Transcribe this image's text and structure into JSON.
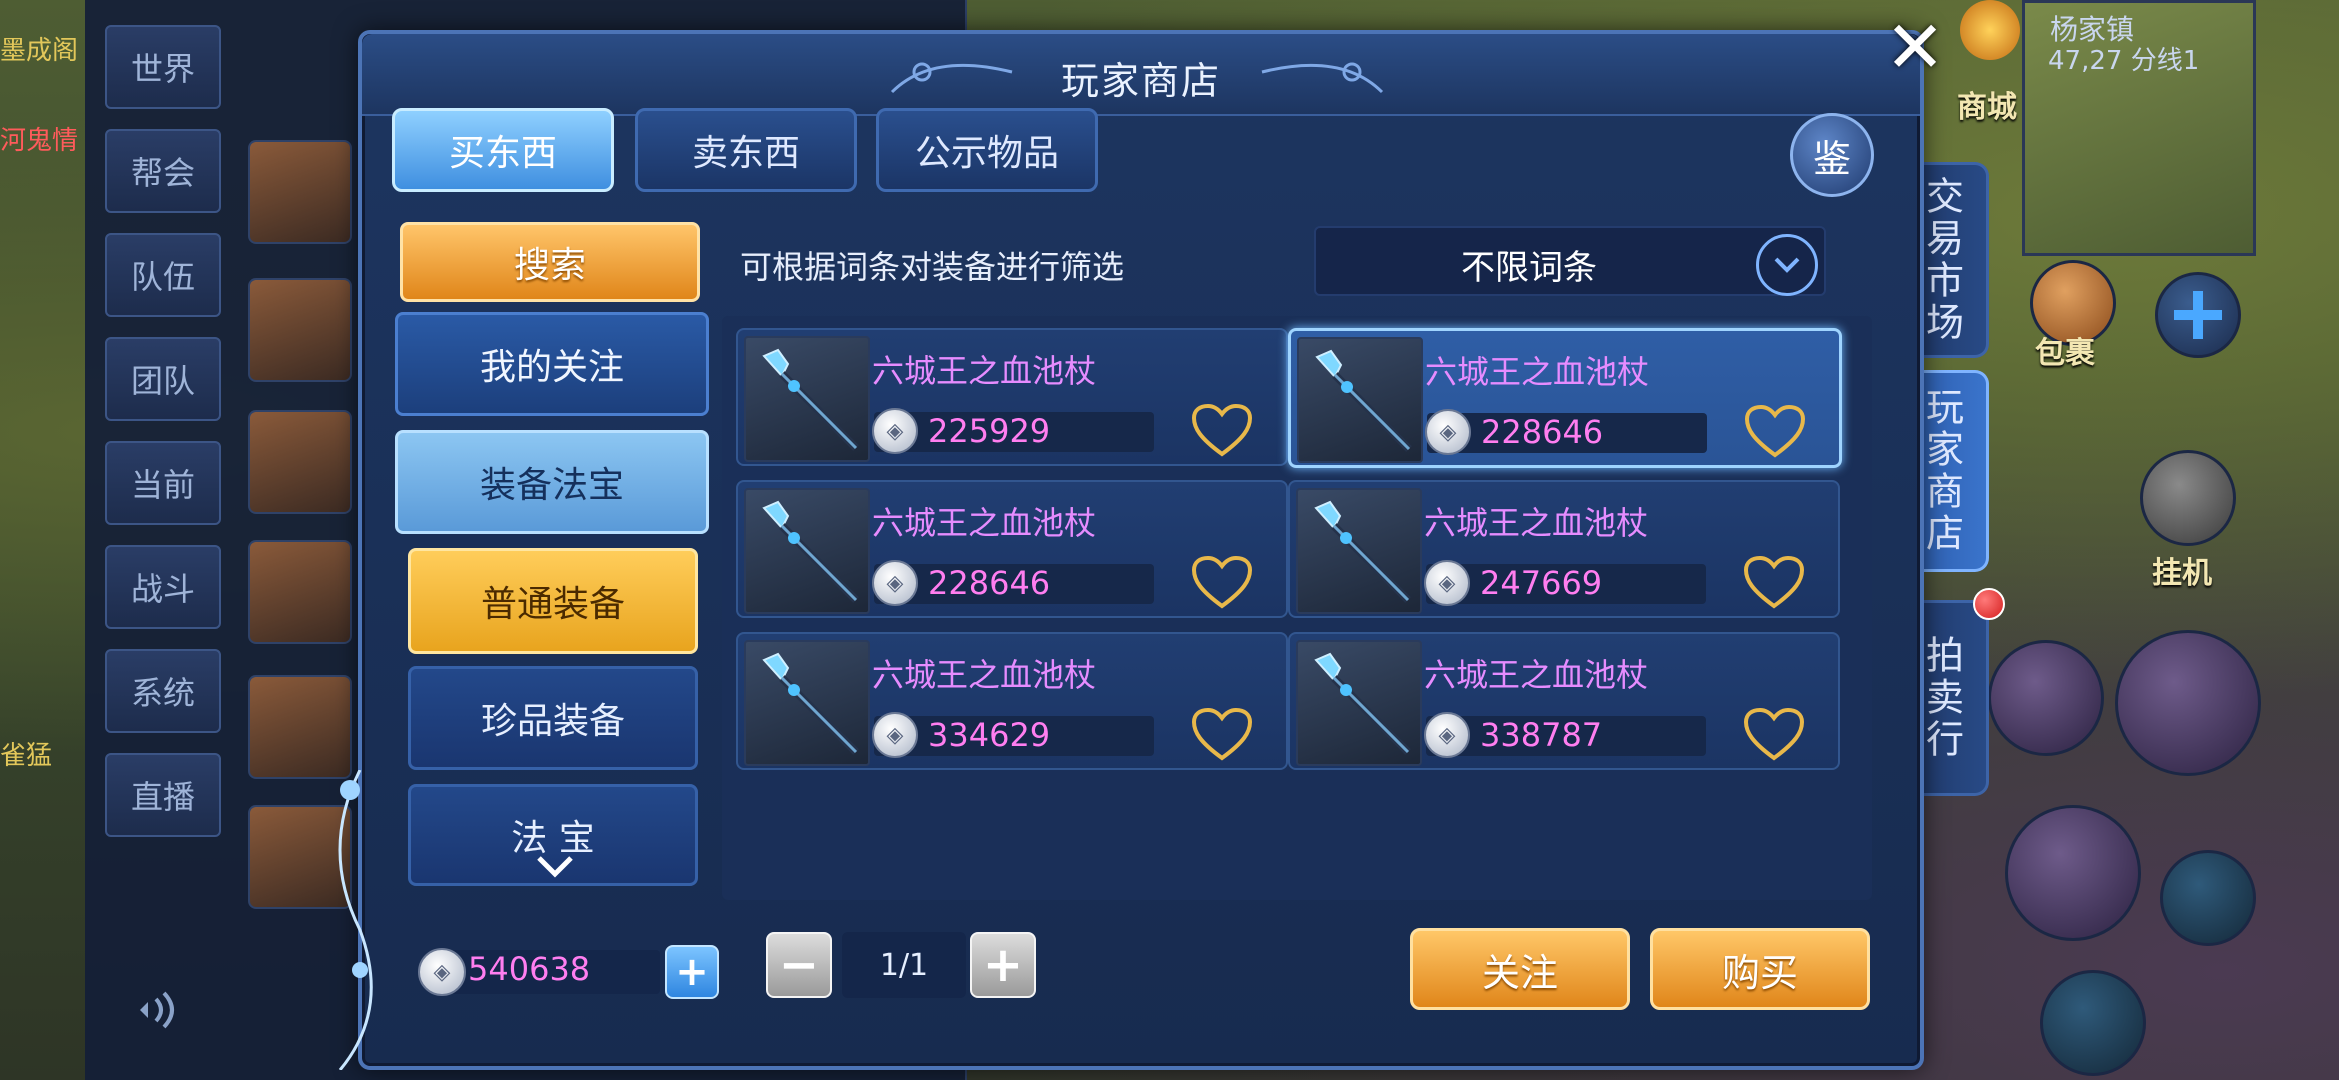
{
  "dialog": {
    "title": "玩家商店",
    "close_icon": "close-icon"
  },
  "tabs": [
    {
      "label": "买东西",
      "active": true
    },
    {
      "label": "卖东西",
      "active": false
    },
    {
      "label": "公示物品",
      "active": false
    }
  ],
  "jian_button": "鉴",
  "menu": {
    "search": "搜索",
    "my_follow": "我的关注",
    "equip_magic": "装备法宝",
    "sub_items": [
      {
        "label": "普通装备",
        "active": true
      },
      {
        "label": "珍品装备",
        "active": false
      },
      {
        "label": "法 宝",
        "active": false
      }
    ]
  },
  "filter": {
    "hint": "可根据词条对装备进行筛选",
    "selected": "不限词条"
  },
  "listings": [
    {
      "name": "六城王之血池杖",
      "price": "225929",
      "selected": false
    },
    {
      "name": "六城王之血池杖",
      "price": "228646",
      "selected": true
    },
    {
      "name": "六城王之血池杖",
      "price": "228646",
      "selected": false
    },
    {
      "name": "六城王之血池杖",
      "price": "247669",
      "selected": false
    },
    {
      "name": "六城王之血池杖",
      "price": "334629",
      "selected": false
    },
    {
      "name": "六城王之血池杖",
      "price": "338787",
      "selected": false
    }
  ],
  "bottom": {
    "money": "540638",
    "page": "1/1",
    "follow_btn": "关注",
    "buy_btn": "购买"
  },
  "side_tabs": [
    {
      "label": "交易市场",
      "active": false
    },
    {
      "label": "玩家商店",
      "active": true
    },
    {
      "label": "拍卖行",
      "active": false
    }
  ],
  "chat": {
    "channels": [
      "世界",
      "帮会",
      "队伍",
      "团队",
      "当前",
      "战斗",
      "系统",
      "直播"
    ]
  },
  "left_edge_texts": [
    "墨成阁",
    "河鬼情",
    "雀猛"
  ],
  "minimap": {
    "location": "杨家镇",
    "coords": "47,27 分线1"
  },
  "hud": {
    "mall": "商城",
    "bag": "包裹",
    "auto": "挂机"
  },
  "colors": {
    "dialog_bg": "#1d3560",
    "accent_orange": "#e0861a",
    "price_pink": "#ff7ef0",
    "item_name_purple": "#e68cff",
    "selected_border": "#9fd4ff"
  }
}
